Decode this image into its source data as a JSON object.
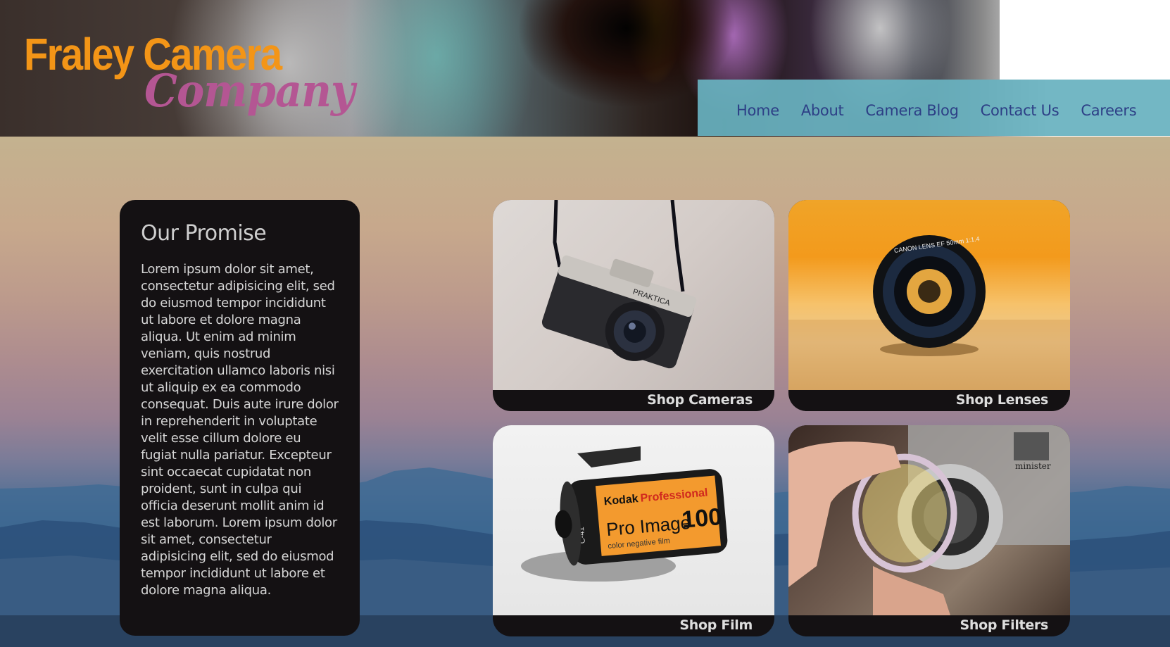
{
  "brand": {
    "line1": "Fraley Camera",
    "line2": "Company"
  },
  "nav": {
    "items": [
      "Home",
      "About",
      "Camera Blog",
      "Contact Us",
      "Careers"
    ]
  },
  "promise": {
    "title": "Our Promise",
    "body": "Lorem ipsum dolor sit amet, consectetur adipisicing elit, sed do eiusmod tempor incididunt ut labore et dolore magna aliqua. Ut enim ad minim veniam, quis nostrud exercitation ullamco laboris nisi ut aliquip ex ea commodo consequat. Duis aute irure dolor in reprehenderit in voluptate velit esse cillum dolore eu fugiat nulla pariatur. Excepteur sint occaecat cupidatat non proident, sunt in culpa qui officia deserunt mollit anim id est laborum. Lorem ipsum dolor sit amet, consectetur adipisicing elit, sed do eiusmod tempor incididunt ut labore et dolore magna aliqua."
  },
  "tiles": [
    {
      "caption": "Shop Cameras",
      "camera_label": "PRAKTICA"
    },
    {
      "caption": "Shop Lenses",
      "lens_label": "CANON LENS EF 50mm 1:1.4"
    },
    {
      "caption": "Shop Film",
      "film_brand": "Kodak",
      "film_line": "Professional",
      "film_name": "Pro Image",
      "film_iso": "100",
      "film_sub": "color negative film",
      "film_code": "C-41"
    },
    {
      "caption": "Shop Filters",
      "camera_label": "minister"
    }
  ],
  "colors": {
    "logo_orange": "#f39517",
    "logo_purple": "#b45693",
    "nav_bg": "#68b2bf",
    "nav_text": "#2d3f86",
    "card_bg": "#141113"
  }
}
